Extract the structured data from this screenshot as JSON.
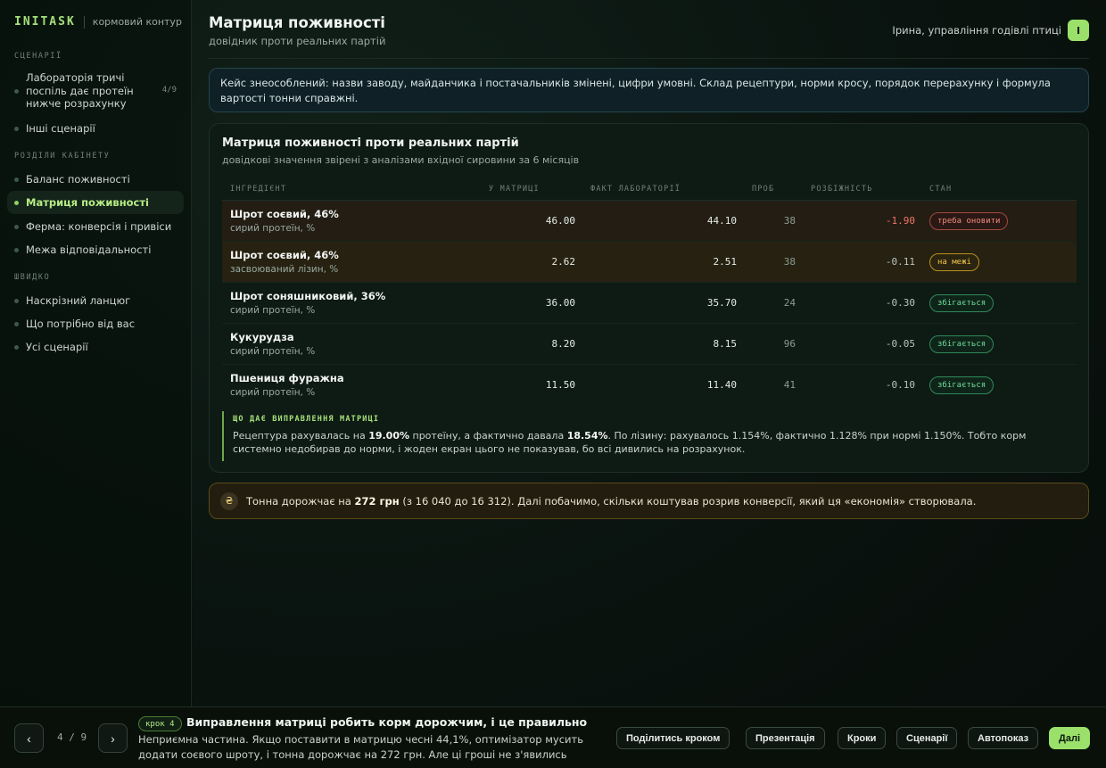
{
  "brand": {
    "logo": "INITASK",
    "subtitle": "кормовий контур"
  },
  "sidebar": {
    "sections": [
      {
        "label": "СЦЕНАРІЇ"
      },
      {
        "label": "РОЗДІЛИ КАБІНЕТУ"
      },
      {
        "label": "ШВИДКО"
      }
    ],
    "scenario_items": [
      {
        "label": "Лабораторія тричі поспіль дає протеїн нижче розрахунку",
        "count": "4/9"
      },
      {
        "label": "Інші сценарії"
      }
    ],
    "cabinet_items": [
      {
        "label": "Баланс поживності"
      },
      {
        "label": "Матриця поживності"
      },
      {
        "label": "Ферма: конверсія і привіси"
      },
      {
        "label": "Межа відповідальності"
      }
    ],
    "quick_items": [
      {
        "label": "Наскрізний ланцюг"
      },
      {
        "label": "Що потрібно від вас"
      },
      {
        "label": "Усі сценарії"
      }
    ]
  },
  "header": {
    "title": "Матриця поживності",
    "subtitle": "довідник проти реальних партій",
    "user_name": "Ірина, управління годівлі птиці",
    "avatar_letter": "І"
  },
  "notice": {
    "text": "Кейс знеособлений: назви заводу, майданчика і постачальників змінені, цифри умовні. Склад рецептури, норми кросу, порядок перерахунку і формула вартості тонни справжні."
  },
  "card": {
    "title": "Матриця поживності проти реальних партій",
    "subtitle": "довідкові значення звірені з аналізами вхідної сировини за 6 місяців",
    "columns": {
      "ingredient": "ІНГРЕДІЄНТ",
      "matrix": "У МАТРИЦІ",
      "fact": "ФАКТ ЛАБОРАТОРІЇ",
      "probes": "ПРОБ",
      "diff": "РОЗБІЖНІСТЬ",
      "status": "СТАН"
    },
    "rows": [
      {
        "name": "Шрот соєвий, 46%",
        "unit": "сирий протеїн, %",
        "matrix": "46.00",
        "fact": "44.10",
        "probes": "38",
        "diff": "-1.90",
        "status": "треба оновити"
      },
      {
        "name": "Шрот соєвий, 46%",
        "unit": "засвоюваний лізин, %",
        "matrix": "2.62",
        "fact": "2.51",
        "probes": "38",
        "diff": "-0.11",
        "status": "на межі"
      },
      {
        "name": "Шрот соняшниковий, 36%",
        "unit": "сирий протеїн, %",
        "matrix": "36.00",
        "fact": "35.70",
        "probes": "24",
        "diff": "-0.30",
        "status": "збігається"
      },
      {
        "name": "Кукурудза",
        "unit": "сирий протеїн, %",
        "matrix": "8.20",
        "fact": "8.15",
        "probes": "96",
        "diff": "-0.05",
        "status": "збігається"
      },
      {
        "name": "Пшениця фуражна",
        "unit": "сирий протеїн, %",
        "matrix": "11.50",
        "fact": "11.40",
        "probes": "41",
        "diff": "-0.10",
        "status": "збігається"
      }
    ],
    "insight": {
      "label": "ЩО ДАЄ ВИПРАВЛЕННЯ МАТРИЦІ",
      "pre": "Рецептура рахувалась на ",
      "v1": "19.00%",
      "mid": " протеїну, а фактично давала ",
      "v2": "18.54%",
      "post": ". По лізину: рахувалось 1.154%, фактично 1.128% при нормі 1.150%. Тобто корм системно недобирав до норми, і жоден екран цього не показував, бо всі дивились на розрахунок."
    }
  },
  "cost": {
    "icon": "₴",
    "pre": "Тонна дорожчає на ",
    "amount": "272 грн",
    "post": " (з 16 040 до 16 312). Далі побачимо, скільки коштував розрив конверсії, який ця «економія» створювала."
  },
  "footer": {
    "prev": "‹",
    "next": "›",
    "pager": "4 / 9",
    "step_badge": "крок 4",
    "step_title": "Виправлення матриці робить корм дорожчим, і це правильно",
    "step_text": "Неприємна частина. Якщо поставити в матрицю чесні 44,1%, оптимізатор мусить додати соєвого шроту, і тонна дорожчає на 272 грн. Але ці гроші не з'явились зараз, вони весь...",
    "buttons": {
      "share": "Поділитись кроком",
      "presentation": "Презентація",
      "steps": "Кроки",
      "scenarios": "Сценарії",
      "autoplay": "Автопоказ",
      "next": "Далі"
    }
  },
  "colors": {
    "accent": "#9be06a",
    "danger": "#f07566",
    "warning": "#f2c64b",
    "success": "#6fdc9c"
  }
}
